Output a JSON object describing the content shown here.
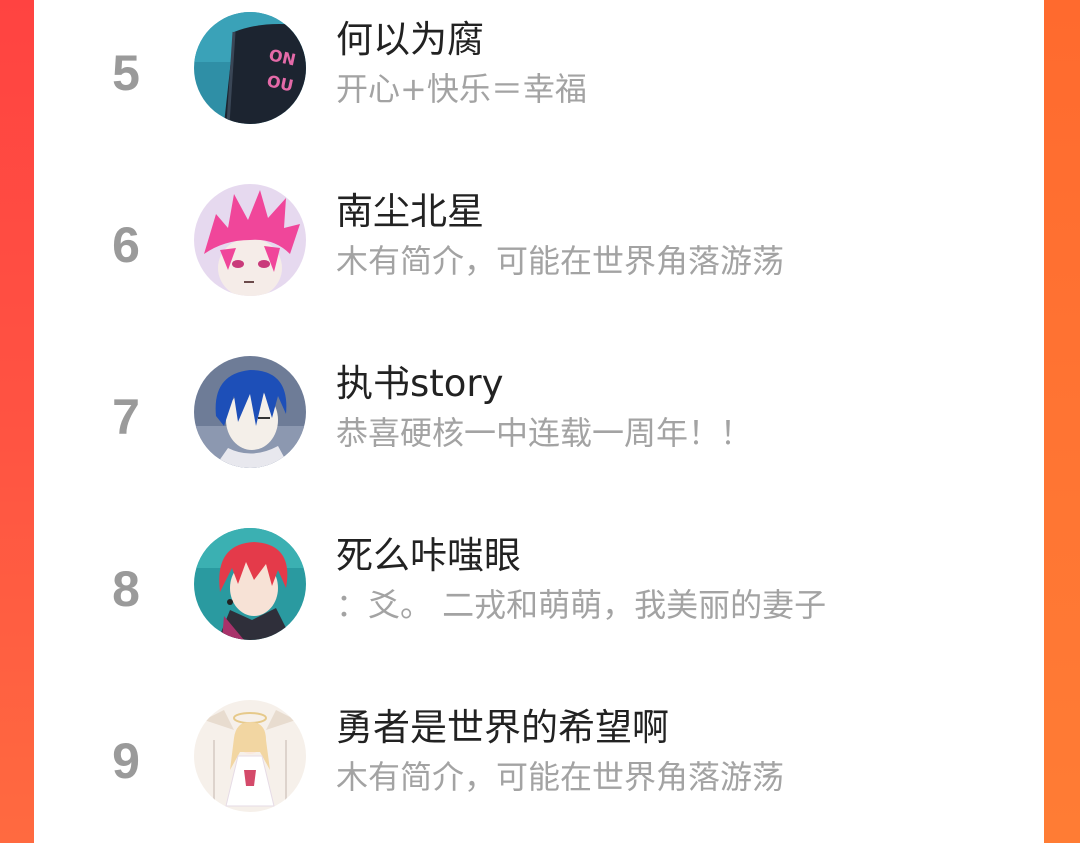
{
  "ranking": {
    "items": [
      {
        "rank": "5",
        "name": "何以为腐",
        "desc": "开心+快乐＝幸福",
        "avatar_icon": "avatar-dark-shirt"
      },
      {
        "rank": "6",
        "name": "南尘北星",
        "desc": "木有简介，可能在世界角落游荡",
        "avatar_icon": "avatar-pink-hair"
      },
      {
        "rank": "7",
        "name": "执书story",
        "desc": "恭喜硬核一中连载一周年！！",
        "avatar_icon": "avatar-blue-hair"
      },
      {
        "rank": "8",
        "name": "死么咔嗤眼",
        "desc": "：爻。 二戎和萌萌，我美丽的妻子",
        "avatar_icon": "avatar-red-hair"
      },
      {
        "rank": "9",
        "name": "勇者是世界的希望啊",
        "desc": "木有简介，可能在世界角落游荡",
        "avatar_icon": "avatar-angel-girl"
      }
    ]
  },
  "colors": {
    "background_gradient_top": "#ff4a3e",
    "background_gradient_bottom": "#ff7a32",
    "rank_text": "#9a9a9a",
    "name_text": "#222222",
    "desc_text": "#a3a3a3",
    "card": "#ffffff"
  }
}
